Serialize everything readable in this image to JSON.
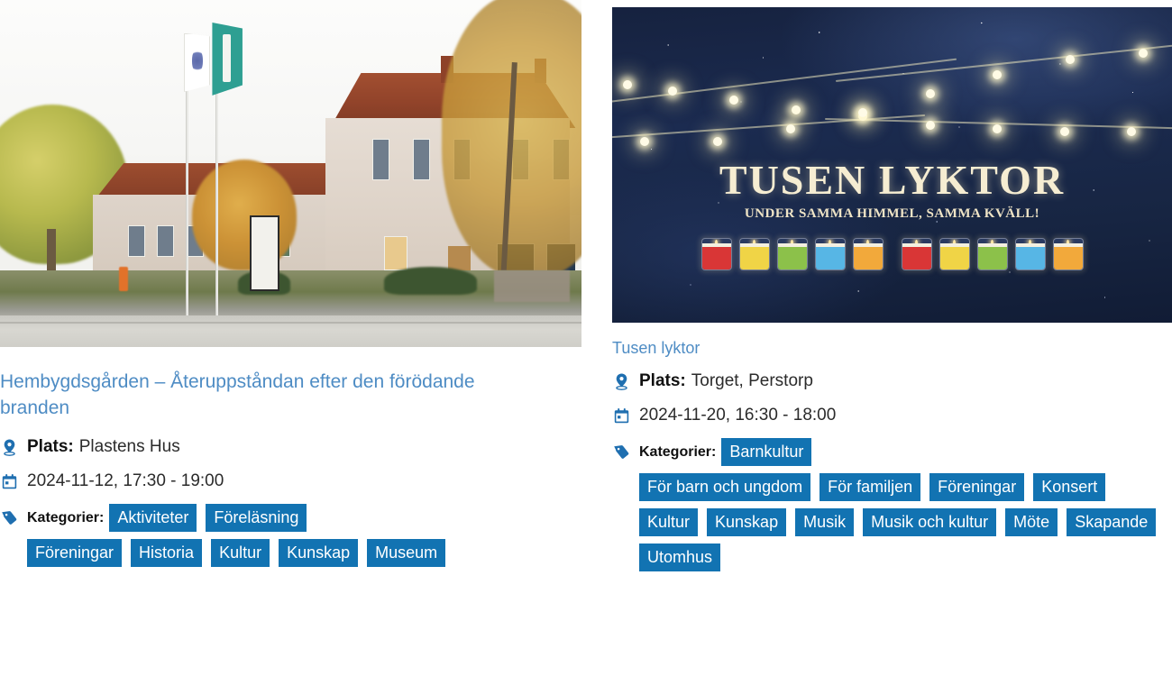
{
  "events": [
    {
      "image": {
        "name": "hembygdsgarden-photo",
        "alt": "Fotografi av Plastens Hus med flaggstanger och hostträd"
      },
      "title": "Hembygdsgården – Återuppståndan efter den förödande branden",
      "location_label": "Plats:",
      "location_value": "Plastens Hus",
      "date": "2024-11-12, 17:30 - 19:00",
      "categories_label": "Kategorier:",
      "categories": [
        "Aktiviteter",
        "Föreläsning",
        "Föreningar",
        "Historia",
        "Kultur",
        "Kunskap",
        "Museum"
      ]
    },
    {
      "image": {
        "name": "tusen-lyktor-poster",
        "title": "TUSEN LYKTOR",
        "subtitle": "UNDER SAMMA HIMMEL, SAMMA KVÄLL!",
        "lantern_colors": [
          "#d93636",
          "#f0d446",
          "#8cc14a",
          "#57b6e5",
          "#f2a93b",
          "#d93636",
          "#f0d446",
          "#8cc14a",
          "#57b6e5",
          "#f2a93b"
        ],
        "background_color": "#172542"
      },
      "title": "Tusen lyktor",
      "location_label": "Plats:",
      "location_value": "Torget, Perstorp",
      "date": "2024-11-20, 16:30 - 18:00",
      "categories_label": "Kategorier:",
      "categories": [
        "Barnkultur",
        "För barn och ungdom",
        "För familjen",
        "Föreningar",
        "Konsert",
        "Kultur",
        "Kunskap",
        "Musik",
        "Musik och kultur",
        "Möte",
        "Skapande",
        "Utomhus"
      ]
    }
  ],
  "icons": {
    "location": "location-pin-icon",
    "date": "calendar-icon",
    "category": "tag-icon"
  },
  "colors": {
    "link": "#4e8cc4",
    "tag_background": "#1273b2",
    "tag_text": "#ffffff",
    "text": "#2a2a2a",
    "page_background": "#ffffff"
  }
}
